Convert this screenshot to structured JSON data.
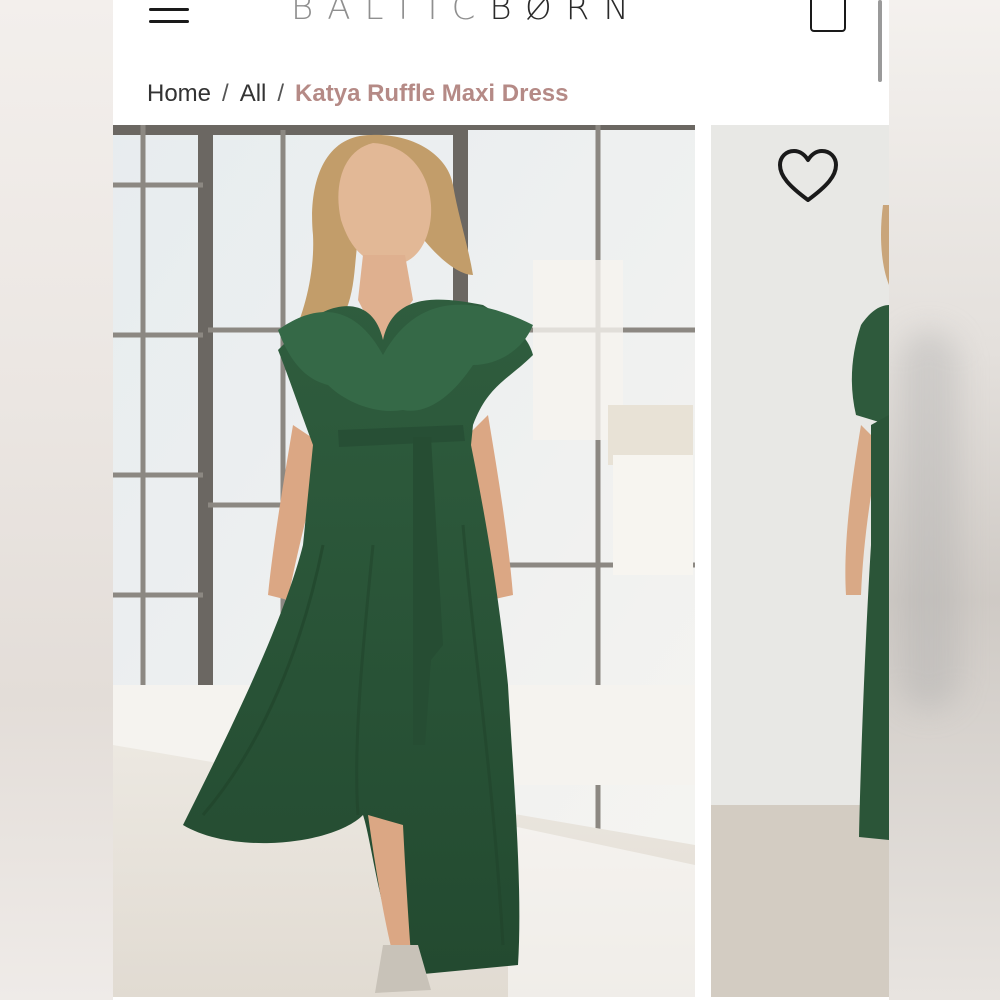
{
  "header": {
    "logo_light": "BALTIC",
    "logo_strong": "BØRN",
    "menu_icon": "hamburger-menu-icon",
    "cart_icon": "shopping-bag-icon"
  },
  "breadcrumb": {
    "home": "Home",
    "separator": "/",
    "all": "All",
    "current": "Katya Ruffle Maxi Dress"
  },
  "gallery": {
    "wishlist_icon": "heart-icon",
    "dress_color": "#2e5a3c"
  },
  "colors": {
    "accent": "#b58a86",
    "text": "#333333"
  }
}
